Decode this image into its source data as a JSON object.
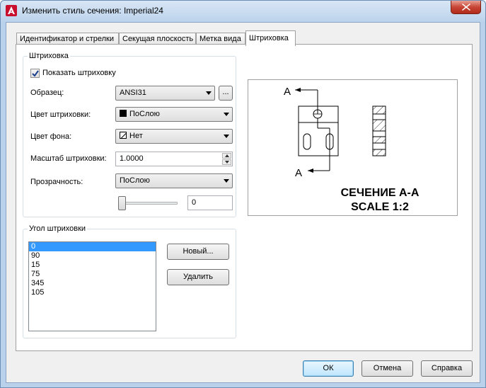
{
  "window": {
    "title": "Изменить стиль сечения: Imperial24",
    "colors": {
      "titlebar": "#bcd3ec",
      "close": "#c74535",
      "selection": "#3399ff"
    }
  },
  "tabs": [
    {
      "label": "Идентификатор и стрелки"
    },
    {
      "label": "Секущая плоскость"
    },
    {
      "label": "Метка вида"
    },
    {
      "label": "Штриховка"
    }
  ],
  "hatch_group": {
    "legend": "Штриховка",
    "show_hatch_label": "Показать штриховку",
    "show_hatch_checked": true,
    "pattern_label": "Образец:",
    "pattern_value": "ANSI31",
    "browse_label": "...",
    "color_label": "Цвет штриховки:",
    "color_value": "ПоСлою",
    "bg_label": "Цвет фона:",
    "bg_value": "Нет",
    "scale_label": "Масштаб штриховки:",
    "scale_value": "1.0000",
    "transparency_label": "Прозрачность:",
    "transparency_value": "ПоСлою",
    "transparency_slider_level": 0,
    "transparency_number": "0"
  },
  "angle_group": {
    "legend": "Угол штриховки",
    "angles": [
      "0",
      "90",
      "15",
      "75",
      "345",
      "105"
    ],
    "selected_index": 0,
    "new_button": "Новый...",
    "delete_button": "Удалить"
  },
  "preview": {
    "arrow_label_top": "A",
    "arrow_label_bottom": "A",
    "caption_line1": "СЕЧЕНИЕ А-А",
    "caption_line2": "SCALE 1:2"
  },
  "footer": {
    "ok": "ОК",
    "cancel": "Отмена",
    "help": "Справка"
  }
}
